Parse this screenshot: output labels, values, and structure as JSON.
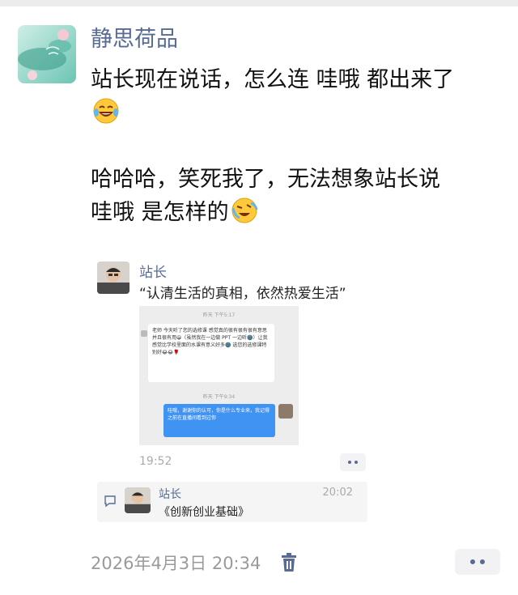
{
  "post": {
    "author": "静思荷品",
    "text_line1": "站长现在说话，怎么连 哇哦 都出来了",
    "text_line3a": "哈哈哈，笑死我了，无法想象站长说",
    "text_line3b": "哇哦 是怎样的",
    "timestamp": "2026年4月3日 20:34"
  },
  "shared": {
    "author": "站长",
    "text": "“认清生活的真相，依然热爱生活”",
    "time": "19:52",
    "screenshot": {
      "ts1": "昨天 下午5:17",
      "msg1": "老师 今天听了您的选修课 感觉真的很有很有很有意思 并且很有用😁（虽然我在一边做 PPT 一边听🌚）让我感觉比学校里面的水课有意义好多🌚 选您的选修课特别好😂😂🌹",
      "ts2": "昨天 下午9:34",
      "msg2": "哇哦，谢谢你的认可，你是什么专业来，我记得之前在直播间看到过你"
    },
    "comment": {
      "name": "站长",
      "time": "20:02",
      "text": "《创新创业基础》"
    }
  },
  "colors": {
    "link": "#576b95",
    "bubble_blue": "#3f93f3",
    "meta_gray": "#9a9a9a"
  },
  "icons": [
    "laughing-tears-emoji-icon",
    "crying-laughing-emoji-icon",
    "comment-icon",
    "trash-icon",
    "more-dots-icon"
  ]
}
